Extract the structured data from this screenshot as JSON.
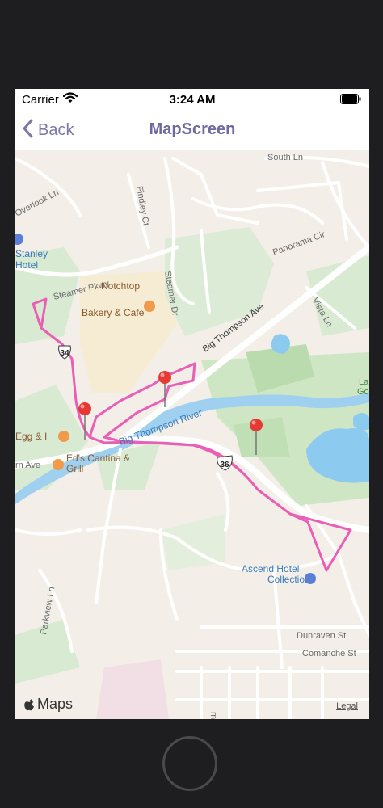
{
  "status_bar": {
    "carrier": "Carrier",
    "time": "3:24 AM"
  },
  "nav_bar": {
    "back_label": "Back",
    "title": "MapScreen"
  },
  "map": {
    "road_labels": {
      "south_ln": "South Ln",
      "overlook_ln": "Overlook Ln",
      "findley_ct": "Findley Ct",
      "panorama_cir": "Panorama Cir",
      "steamer_pkwy": "Steamer Pkwy",
      "steamer_dr": "Steamer Dr",
      "big_thompson_ave": "Big Thompson Ave",
      "vista_ln": "Vista Ln",
      "big_thompson_river": "Big Thompson River",
      "parkview_ln": "Parkview Ln",
      "dunraven_st": "Dunraven St",
      "comanche_st": "Comanche St",
      "stanley_hotel_1": "Stanley",
      "stanley_hotel_2": "Hotel",
      "lake_1": "La",
      "lake_2": "Go",
      "ave_fragment": "rn Ave",
      "m_ave_fragment": "m Ave",
      "hwy_34": "34",
      "hwy_36": "36"
    },
    "pois": {
      "notchtop_1": "Notchtop",
      "notchtop_2": "Bakery & Cafe",
      "egg_and_i": "Egg & I",
      "eds_cantina_1": "Ed's Cantina &",
      "eds_cantina_2": "Grill",
      "ascend_1": "Ascend Hotel",
      "ascend_2": "Collection"
    },
    "pins": [
      {
        "name": "pin-1"
      },
      {
        "name": "pin-2"
      },
      {
        "name": "pin-3"
      }
    ],
    "route_color": "#e85fb5",
    "pin_color": "#e53935",
    "logo_label": "Maps",
    "legal_label": "Legal"
  }
}
